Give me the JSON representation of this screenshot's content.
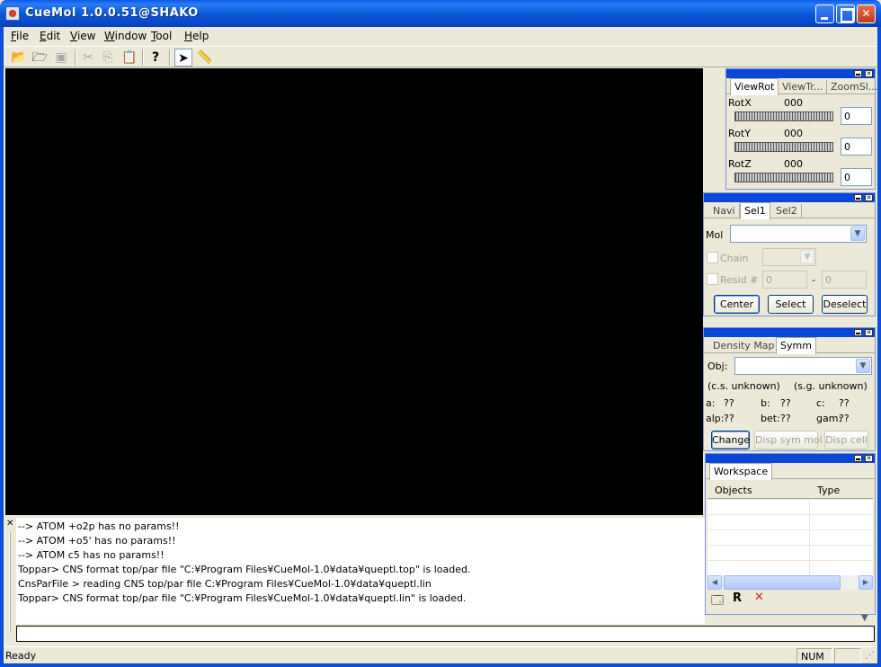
{
  "window": {
    "title": "CueMol 1.0.0.51@SHAKO"
  },
  "menu": [
    {
      "label": "File",
      "accel": "F",
      "rest": "ile"
    },
    {
      "label": "Edit",
      "accel": "E",
      "rest": "dit"
    },
    {
      "label": "View",
      "accel": "V",
      "rest": "iew"
    },
    {
      "label": "Window",
      "accel": "W",
      "rest": "indow"
    },
    {
      "label": "Tool",
      "accel": "T",
      "rest": "ool"
    },
    {
      "label": "Help",
      "accel": "H",
      "rest": "elp"
    }
  ],
  "toolbar": {
    "icons": [
      "open-folder-icon",
      "open-file-icon",
      "save-icon",
      "cut-icon",
      "copy-icon",
      "paste-icon",
      "help-icon",
      "pointer-icon",
      "ruler-icon"
    ]
  },
  "viewrot": {
    "tabs": [
      "ViewRot",
      "ViewTr...",
      "ZoomSl..."
    ],
    "rows": [
      {
        "label": "RotX",
        "value_text": "000",
        "input": "0"
      },
      {
        "label": "RotY",
        "value_text": "000",
        "input": "0"
      },
      {
        "label": "RotZ",
        "value_text": "000",
        "input": "0"
      }
    ]
  },
  "selection": {
    "tabs": [
      "Navi",
      "Sel1",
      "Sel2"
    ],
    "mol_label": "Mol",
    "chain_label": "Chain",
    "resid_label": "Resid #",
    "resid_from": "0",
    "resid_sep": "-",
    "resid_to": "0",
    "buttons": {
      "center": "Center",
      "select": "Select",
      "deselect": "Deselect"
    }
  },
  "symm": {
    "tabs": [
      "Density Map",
      "Symm"
    ],
    "obj_label": "Obj:",
    "cs": "(c.s. unknown)",
    "sg": "(s.g. unknown)",
    "cell": [
      {
        "k": "a:",
        "v": "??"
      },
      {
        "k": "b:",
        "v": "??"
      },
      {
        "k": "c:",
        "v": "??"
      },
      {
        "k": "alp:",
        "v": "??"
      },
      {
        "k": "bet:",
        "v": "??"
      },
      {
        "k": "gam:",
        "v": "??"
      }
    ],
    "buttons": {
      "change": "Change",
      "disp_sym": "Disp sym mol",
      "disp_cell": "Disp cell"
    }
  },
  "workspace": {
    "tab": "Workspace",
    "columns": [
      "Objects",
      "Type"
    ],
    "rows": 5
  },
  "log": {
    "lines": [
      "  --> ATOM +o2p has no params!!",
      "  --> ATOM +o5' has no params!!",
      "  --> ATOM c5 has no params!!",
      "Toppar> CNS format top/par file \"C:¥Program Files¥CueMol-1.0¥data¥queptl.top\" is loaded.",
      "CnsParFile > reading CNS top/par file C:¥Program Files¥CueMol-1.0¥data¥queptl.lin",
      "Toppar> CNS format top/par file \"C:¥Program Files¥CueMol-1.0¥data¥queptl.lin\" is loaded."
    ]
  },
  "status": {
    "text": "Ready",
    "num": "NUM"
  },
  "colors": {
    "titlebar": "#0a5ae8",
    "viewport": "#000000",
    "panel_head": "#0a46d8",
    "face": "#ece9d8"
  }
}
